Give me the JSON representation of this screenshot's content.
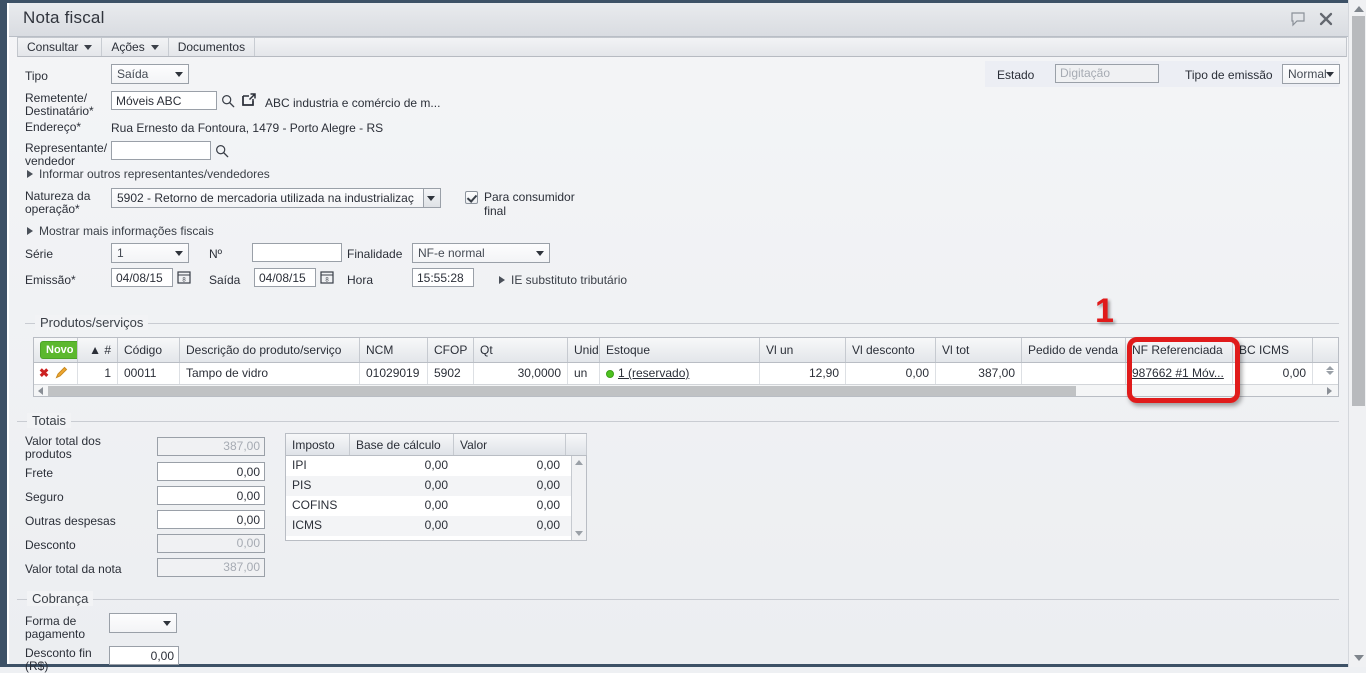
{
  "window": {
    "title": "Nota fiscal",
    "comment_icon": "speech-bubble-icon",
    "close_icon": "close-icon"
  },
  "menu": {
    "items": [
      {
        "label": "Consultar",
        "has_caret": true
      },
      {
        "label": "Ações",
        "has_caret": true
      },
      {
        "label": "Documentos",
        "has_caret": false
      }
    ]
  },
  "form": {
    "tipo_label": "Tipo",
    "tipo_value": "Saída",
    "remetente_label": "Remetente/\nDestinatário*",
    "remetente_label_l1": "Remetente/",
    "remetente_label_l2": "Destinatário*",
    "remetente_value": "Móveis ABC",
    "remetente_info": "ABC industria e comércio de m...",
    "endereco_label": "Endereço*",
    "endereco_value": "Rua Ernesto da Fontoura, 1479 - Porto Alegre - RS",
    "representante_label_l1": "Representante/",
    "representante_label_l2": "vendedor",
    "representante_value": "",
    "informar_outros": "Informar outros representantes/vendedores",
    "natureza_label_l1": "Natureza da",
    "natureza_label_l2": "operação*",
    "natureza_value": "5902 - Retorno de mercadoria utilizada na industrializaç",
    "consumidor_final_l1": "Para consumidor",
    "consumidor_final_l2": "final",
    "consumidor_final_checked": true,
    "mostrar_mais": "Mostrar mais informações fiscais",
    "serie_label": "Série",
    "serie_value": "1",
    "numero_label": "Nº",
    "numero_value": "",
    "finalidade_label": "Finalidade",
    "finalidade_value": "NF-e normal",
    "emissao_label": "Emissão*",
    "emissao_value": "04/08/15",
    "saida_label": "Saída",
    "saida_value": "04/08/15",
    "hora_label": "Hora",
    "hora_value": "15:55:28",
    "ie_substituto": "IE substituto tributário",
    "estado_label": "Estado",
    "estado_value": "Digitação",
    "tipo_emissao_label": "Tipo de emissão",
    "tipo_emissao_value": "Normal"
  },
  "produtos": {
    "group_title": "Produtos/serviços",
    "new_button": "Novo",
    "columns": [
      "▲ #",
      "Código",
      "Descrição do produto/serviço",
      "NCM",
      "CFOP",
      "Qt",
      "Unid",
      "Estoque",
      "Vl un",
      "Vl desconto",
      "Vl tot",
      "Pedido de venda",
      "NF Referenciada",
      "BC ICMS"
    ],
    "row": {
      "index": "1",
      "codigo": "00011",
      "descricao": "Tampo de vidro",
      "ncm": "01029019",
      "cfop": "5902",
      "qt": "30,0000",
      "unid": "un",
      "estoque": "1 (reservado)",
      "vl_un": "12,90",
      "vl_desconto": "0,00",
      "vl_tot": "387,00",
      "pedido_venda": "",
      "nf_referenciada": "987662 #1 Móv...",
      "bc_icms": "0,00"
    }
  },
  "totais": {
    "group_title": "Totais",
    "fields": [
      {
        "label_l1": "Valor total dos",
        "label_l2": "produtos",
        "value": "387,00",
        "readonly": true
      },
      {
        "label_l1": "Frete",
        "label_l2": "",
        "value": "0,00",
        "readonly": false
      },
      {
        "label_l1": "Seguro",
        "label_l2": "",
        "value": "0,00",
        "readonly": false
      },
      {
        "label_l1": "Outras despesas",
        "label_l2": "",
        "value": "0,00",
        "readonly": false
      },
      {
        "label_l1": "Desconto",
        "label_l2": "",
        "value": "0,00",
        "readonly": true
      },
      {
        "label_l1": "Valor total da nota",
        "label_l2": "",
        "value": "387,00",
        "readonly": true
      }
    ],
    "tax_table": {
      "columns": [
        "Imposto",
        "Base de cálculo",
        "Valor"
      ],
      "rows": [
        {
          "imposto": "IPI",
          "base": "0,00",
          "valor": "0,00"
        },
        {
          "imposto": "PIS",
          "base": "0,00",
          "valor": "0,00"
        },
        {
          "imposto": "COFINS",
          "base": "0,00",
          "valor": "0,00"
        },
        {
          "imposto": "ICMS",
          "base": "0,00",
          "valor": "0,00"
        }
      ]
    }
  },
  "cobranca": {
    "group_title": "Cobrança",
    "forma_label_l1": "Forma de",
    "forma_label_l2": "pagamento",
    "forma_value": "",
    "desconto_label_l1": "Desconto fin",
    "desconto_label_l2": "(R$)",
    "desconto_value": "0,00"
  },
  "annotation": {
    "number": "1",
    "color": "#e01b1b"
  }
}
